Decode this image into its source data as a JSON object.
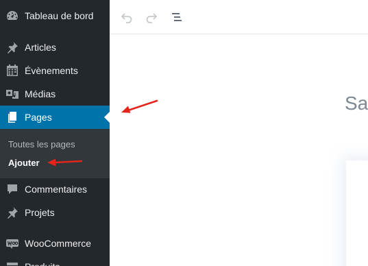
{
  "sidebar": {
    "items": [
      {
        "label": "Tableau de bord",
        "icon": "dashboard-icon"
      },
      {
        "label": "Articles",
        "icon": "pin-icon"
      },
      {
        "label": "Évènements",
        "icon": "calendar-icon"
      },
      {
        "label": "Médias",
        "icon": "media-icon"
      },
      {
        "label": "Pages",
        "icon": "pages-icon",
        "active": true
      },
      {
        "label": "Commentaires",
        "icon": "comment-icon"
      },
      {
        "label": "Projets",
        "icon": "pin-icon"
      },
      {
        "label": "WooCommerce",
        "icon": "woocommerce-icon"
      },
      {
        "label": "Produits",
        "icon": "archive-icon"
      }
    ],
    "submenu": [
      {
        "label": "Toutes les pages"
      },
      {
        "label": "Ajouter",
        "current": true
      }
    ]
  },
  "toolbar": {
    "icons": [
      "undo-icon",
      "redo-icon",
      "block-navigation-icon"
    ]
  },
  "editor": {
    "title_fragment": "Sa"
  },
  "colors": {
    "sidebar_bg": "#23282d",
    "submenu_bg": "#32373c",
    "active_bg": "#0073aa",
    "annotation_arrow": "#e3241b"
  }
}
